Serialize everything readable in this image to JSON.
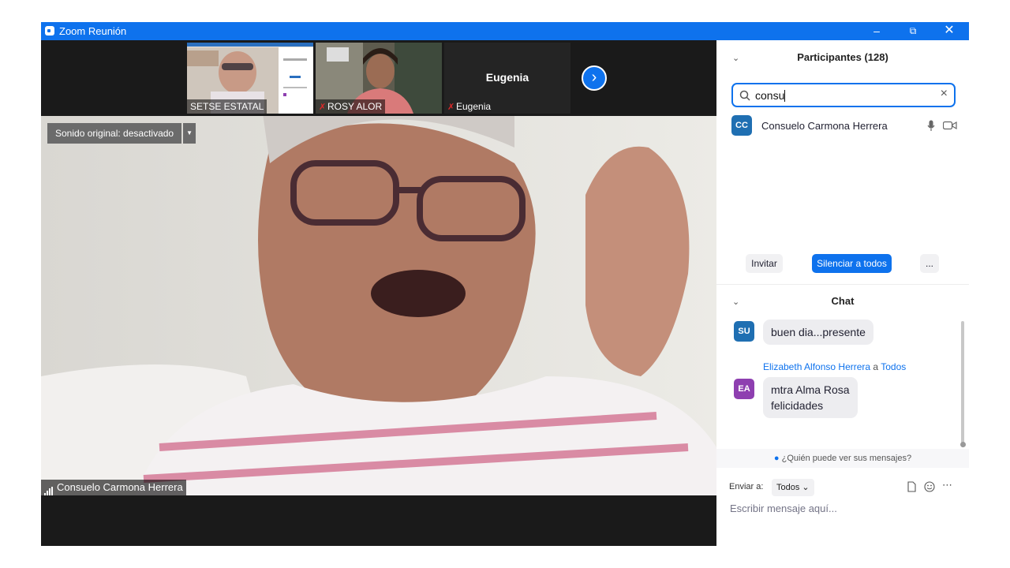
{
  "window": {
    "title": "Zoom Reunión",
    "accent": "#0e72ed"
  },
  "thumbnails": [
    {
      "name": "SETSE ESTATAL",
      "muted": false
    },
    {
      "name": "ROSY ALOR",
      "muted": true
    },
    {
      "name": "Eugenia",
      "display_name": "Eugenia",
      "muted": true
    }
  ],
  "main_video": {
    "sound_label": "Sonido original: desactivado",
    "speaker_name": "Consuelo Carmona Herrera"
  },
  "participants": {
    "header": "Participantes (128)",
    "search_value": "consu",
    "list": [
      {
        "initials": "CC",
        "name": "Consuelo Carmona Herrera",
        "avatar_color": "#1f6fb2"
      }
    ],
    "buttons": {
      "invite": "Invitar",
      "mute_all": "Silenciar a todos",
      "more": "..."
    }
  },
  "chat": {
    "header": "Chat",
    "messages": [
      {
        "initials": "SU",
        "avatar_color": "#1f6fb2",
        "text": "buen dia...presente"
      },
      {
        "initials": "EA",
        "avatar_color": "#8e3fb0",
        "sender": "Elizabeth Alfonso Herrera",
        "to_word": "a",
        "recipient": "Todos",
        "text_line1": "mtra Alma Rosa",
        "text_line2": "felicidades"
      }
    ],
    "visibility_link": "¿Quién puede ver sus mensajes?",
    "send_to_label": "Enviar a:",
    "send_to_value": "Todos",
    "input_placeholder": "Escribir mensaje aquí..."
  }
}
